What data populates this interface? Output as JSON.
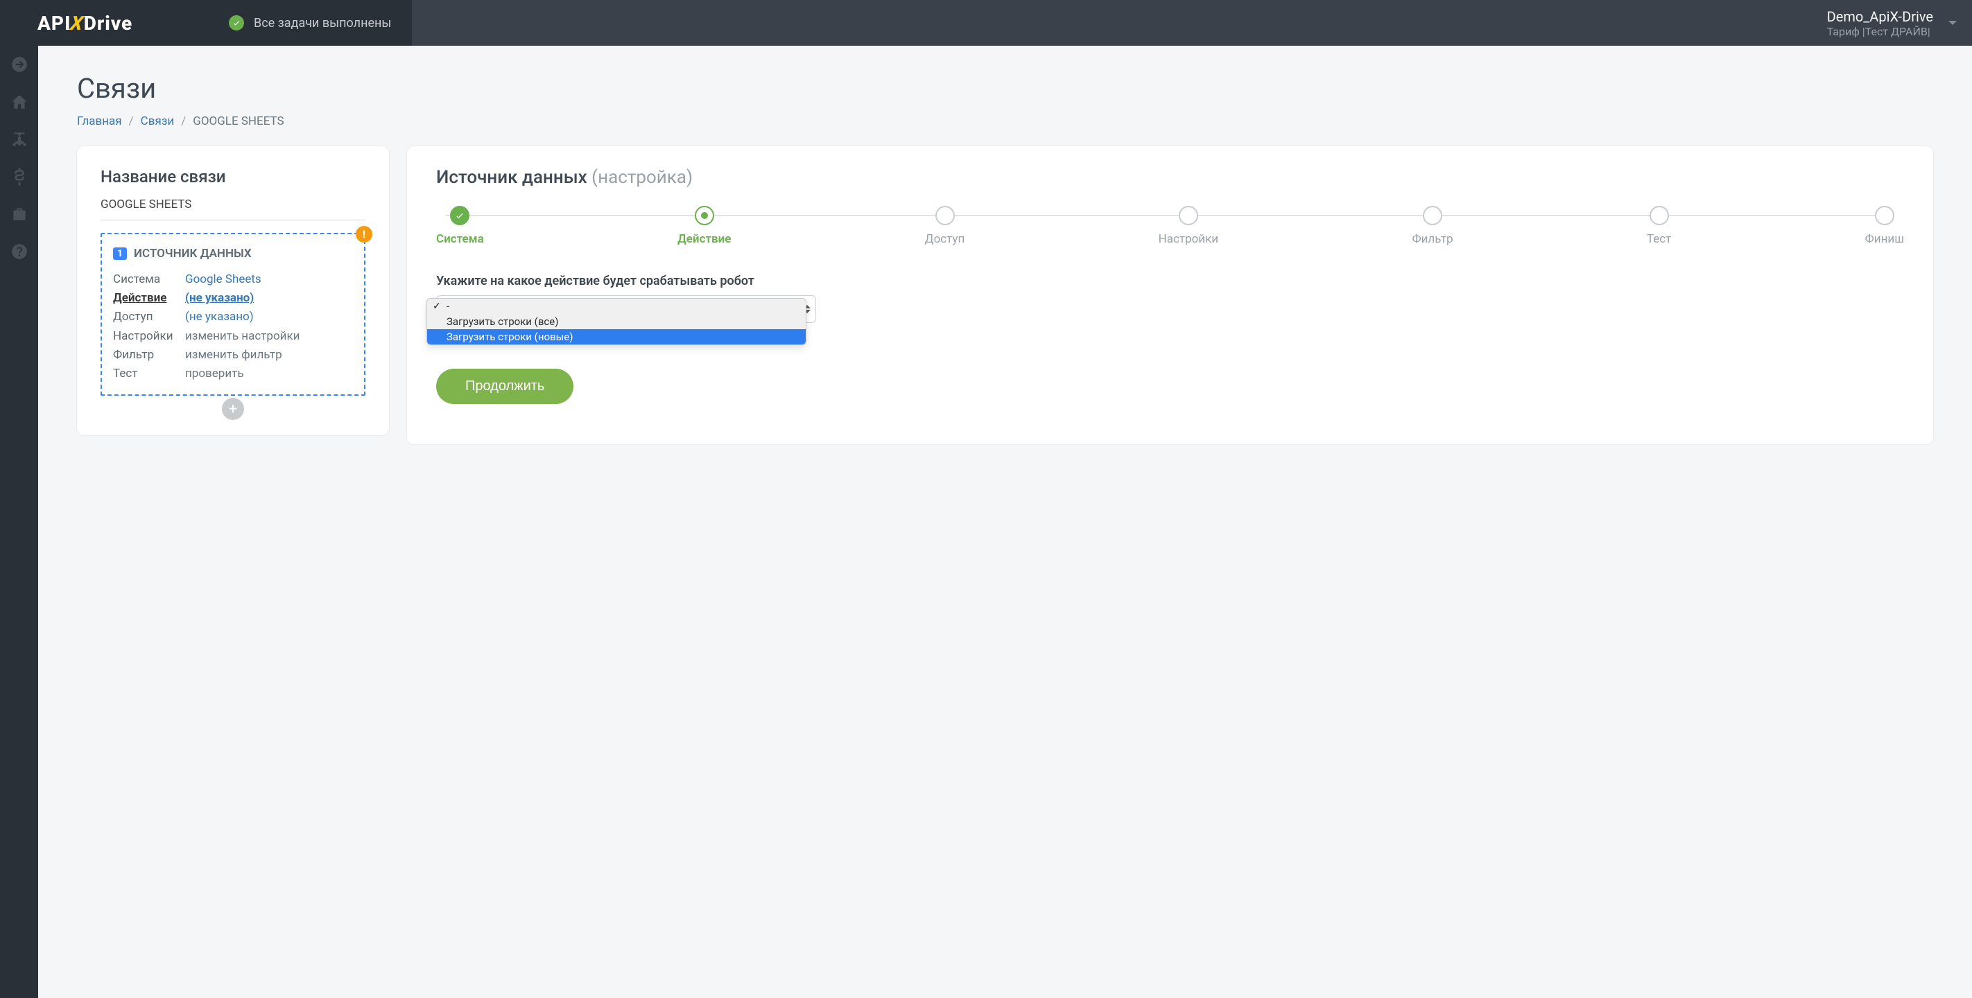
{
  "header": {
    "logo_pre": "API",
    "logo_x": "X",
    "logo_post": "Drive",
    "tasks_status": "Все задачи выполнены",
    "account_name": "Demo_ApiX-Drive",
    "account_tariff": "Тариф |Тест ДРАЙВ|"
  },
  "page": {
    "title": "Связи",
    "breadcrumb_home": "Главная",
    "breadcrumb_links": "Связи",
    "breadcrumb_current": "GOOGLE SHEETS"
  },
  "left_panel": {
    "title": "Название связи",
    "name": "GOOGLE SHEETS",
    "src_num": "1",
    "src_title": "ИСТОЧНИК ДАННЫХ",
    "rows": {
      "system_k": "Система",
      "system_v": "Google Sheets",
      "action_k": "Действие",
      "action_v": "(не указано)",
      "access_k": "Доступ",
      "access_v": "(не указано)",
      "settings_k": "Настройки",
      "settings_v": "изменить настройки",
      "filter_k": "Фильтр",
      "filter_v": "изменить фильтр",
      "test_k": "Тест",
      "test_v": "проверить"
    }
  },
  "right_panel": {
    "title_strong": "Источник данных",
    "title_muted": "(настройка)",
    "steps": [
      {
        "label": "Система",
        "state": "done"
      },
      {
        "label": "Действие",
        "state": "active"
      },
      {
        "label": "Доступ",
        "state": ""
      },
      {
        "label": "Настройки",
        "state": ""
      },
      {
        "label": "Фильтр",
        "state": ""
      },
      {
        "label": "Тест",
        "state": ""
      },
      {
        "label": "Финиш",
        "state": ""
      }
    ],
    "field_label": "Укажите на какое действие будет срабатывать робот",
    "dropdown": {
      "options": [
        {
          "label": "-",
          "selected": true,
          "highlighted": false
        },
        {
          "label": "Загрузить строки (все)",
          "selected": false,
          "highlighted": false
        },
        {
          "label": "Загрузить строки (новые)",
          "selected": false,
          "highlighted": true
        }
      ]
    },
    "continue": "Продолжить"
  }
}
